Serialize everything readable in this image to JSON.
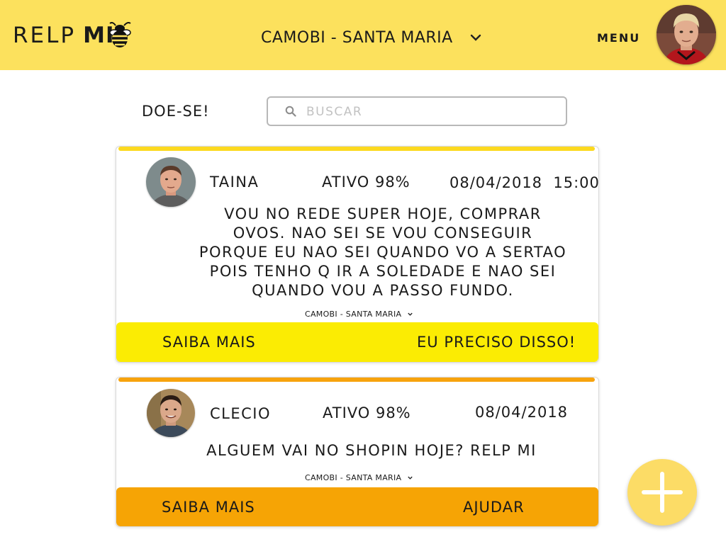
{
  "header": {
    "logo_relp": "RELP",
    "logo_mi": "MI",
    "logo_comma": ",",
    "location": "CAMOBI - SANTA MARIA",
    "menu_label": "MENU",
    "avatar_icon": "user-avatar"
  },
  "search": {
    "label": "DOE-SE!",
    "placeholder": "BUSCAR",
    "value": ""
  },
  "posts": [
    {
      "name": "TAINA",
      "status": "ATIVO 98%",
      "date": "08/04/2018  15:00",
      "text": "VOU NO REDE SUPER HOJE, COMPRAR OVOS. NAO SEI SE VOU CONSEGUIR PORQUE EU NAO SEI QUANDO VO A SERTAO POIS TENHO Q IR A SOLEDADE E NAO SEI QUANDO VOU A PASSO FUNDO.",
      "location": "CAMOBI - SANTA MARIA",
      "btn_more": "SAIBA MAIS",
      "btn_action": "EU PRECISO DISSO!",
      "accent": "#fcd91f",
      "bar_color": "#fbec03"
    },
    {
      "name": "CLECIO",
      "status": "ATIVO 98%",
      "date": "08/04/2018",
      "text": "ALGUEM VAI NO SHOPIN HOJE? RELP MI",
      "location": "CAMOBI - SANTA MARIA",
      "btn_more": "SAIBA MAIS",
      "btn_action": "AJUDAR",
      "accent": "#f7a30d",
      "bar_color": "#f6a405"
    }
  ],
  "fab": {
    "icon": "plus-icon",
    "color": "#fcdc66"
  },
  "colors": {
    "header": "#fce15d"
  }
}
